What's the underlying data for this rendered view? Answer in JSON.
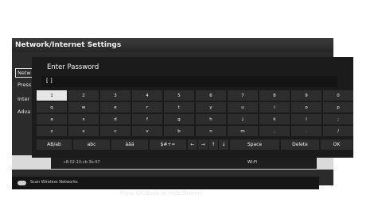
{
  "background_window": {
    "title": "Network/Internet Settings",
    "menu_items": [
      "Netw",
      "Press",
      "Inter",
      "Adva"
    ]
  },
  "footer": {
    "scan_label": "Scan Wireless Networks",
    "faded_text": "Press OK/Back to Hide Button"
  },
  "info_row": {
    "mac": "c8:02:10:cb:3b:97",
    "type": "Wi-Fi"
  },
  "dialog": {
    "title": "Enter Password",
    "password_value": "[ ]"
  },
  "keyboard": {
    "rows": [
      [
        "1",
        "2",
        "3",
        "4",
        "5",
        "6",
        "7",
        "8",
        "9",
        "0"
      ],
      [
        "q",
        "w",
        "e",
        "r",
        "t",
        "y",
        "u",
        "i",
        "o",
        "p"
      ],
      [
        "a",
        "s",
        "d",
        "f",
        "g",
        "h",
        "j",
        "k",
        "l",
        ";"
      ],
      [
        "z",
        "x",
        "c",
        "v",
        "b",
        "n",
        "m",
        ",",
        ".",
        "/"
      ]
    ],
    "selected_key": "1",
    "function_keys": [
      "AB/ab",
      "abc",
      "àâä",
      "$#+=",
      "←",
      "→",
      "↑",
      "↓",
      "Space",
      "Delete",
      "OK"
    ]
  }
}
